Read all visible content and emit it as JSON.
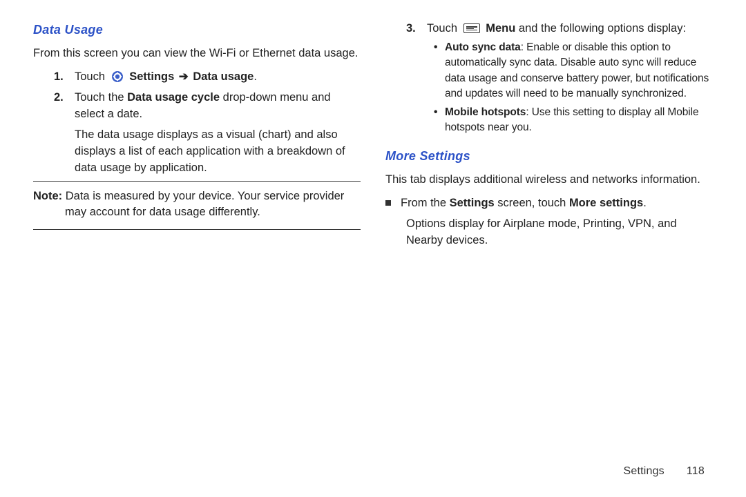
{
  "left": {
    "heading": "Data Usage",
    "intro": "From this screen you can view the Wi-Fi or Ethernet data usage.",
    "step1_pre": "Touch ",
    "step1_settings": "Settings",
    "step1_arrow": " ➔ ",
    "step1_datausage": "Data usage",
    "step1_period": ".",
    "step2_a": "Touch the ",
    "step2_bold": "Data usage cycle",
    "step2_b": " drop-down menu and select a date.",
    "step2_c": "The data usage displays as a visual (chart) and also displays a list of each application with a breakdown of data usage by application.",
    "note_label": "Note:",
    "note_text": " Data is measured by your device. Your service provider may account for data usage differently."
  },
  "right": {
    "step3_pre": "Touch ",
    "step3_menu": "Menu",
    "step3_post": " and the following options display:",
    "bullet1_bold": "Auto sync data",
    "bullet1_text": ": Enable or disable this option to automatically sync data. Disable auto sync will reduce data usage and conserve battery power, but notifications and updates will need to be manually synchronized.",
    "bullet2_bold": "Mobile hotspots",
    "bullet2_text": ": Use this setting to display all Mobile hotspots near you.",
    "more_heading": "More Settings",
    "more_intro": "This tab displays additional wireless and networks information.",
    "from_a": "From the ",
    "from_settings": "Settings",
    "from_b": " screen, touch ",
    "from_moresettings": "More settings",
    "from_period": ".",
    "options_text": "Options display for Airplane mode, Printing, VPN, and Nearby devices."
  },
  "footer": {
    "section": "Settings",
    "page": "118"
  },
  "numbers": {
    "n1": "1.",
    "n2": "2.",
    "n3": "3."
  }
}
